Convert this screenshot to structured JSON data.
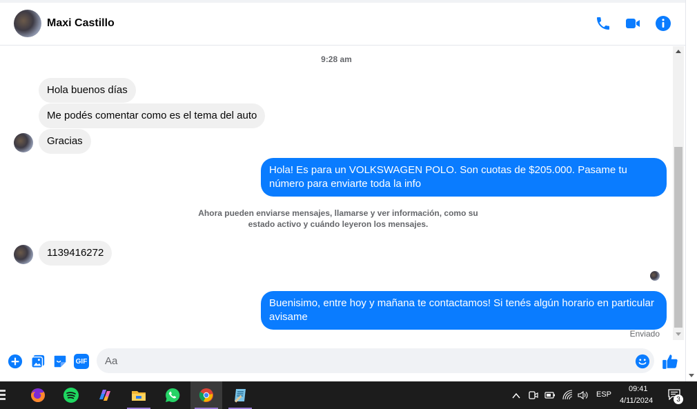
{
  "header": {
    "contact_name": "Maxi Castillo",
    "icons": [
      "phone-icon",
      "video-icon",
      "info-icon"
    ]
  },
  "colors": {
    "accent": "#0a7cff",
    "incoming_bubble": "#f0f0f0",
    "muted_text": "#65676b",
    "taskbar": "#1c1c1c"
  },
  "chat": {
    "timestamp": "9:28 am",
    "incoming_1": "Hola buenos días",
    "incoming_2": "Me podés comentar como es el tema del auto",
    "incoming_3": "Gracias",
    "outgoing_1": "Hola! Es para un VOLKSWAGEN POLO. Son cuotas de $205.000. Pasame tu número para enviarte toda la info",
    "system_note": "Ahora pueden enviarse mensajes, llamarse y ver información, como su estado activo y cuándo leyeron los mensajes.",
    "incoming_4": "1139416272",
    "outgoing_2": "Buenisimo, entre hoy y mañana te contactamos! Si tenés algún horario en particular avisame",
    "status": "Enviado"
  },
  "composer": {
    "placeholder": "Aa",
    "value": "",
    "icons": [
      "plus-icon",
      "image-icon",
      "sticker-icon",
      "gif-icon",
      "emoji-icon",
      "like-icon"
    ],
    "gif_label": "GIF"
  },
  "taskbar": {
    "apps": [
      "firefox-icon",
      "spotify-icon",
      "copilot-icon",
      "file-explorer-icon",
      "whatsapp-icon",
      "chrome-icon",
      "notepad-icon"
    ],
    "language": "ESP",
    "time": "09:41",
    "date": "4/11/2024",
    "notification_count": "3"
  }
}
